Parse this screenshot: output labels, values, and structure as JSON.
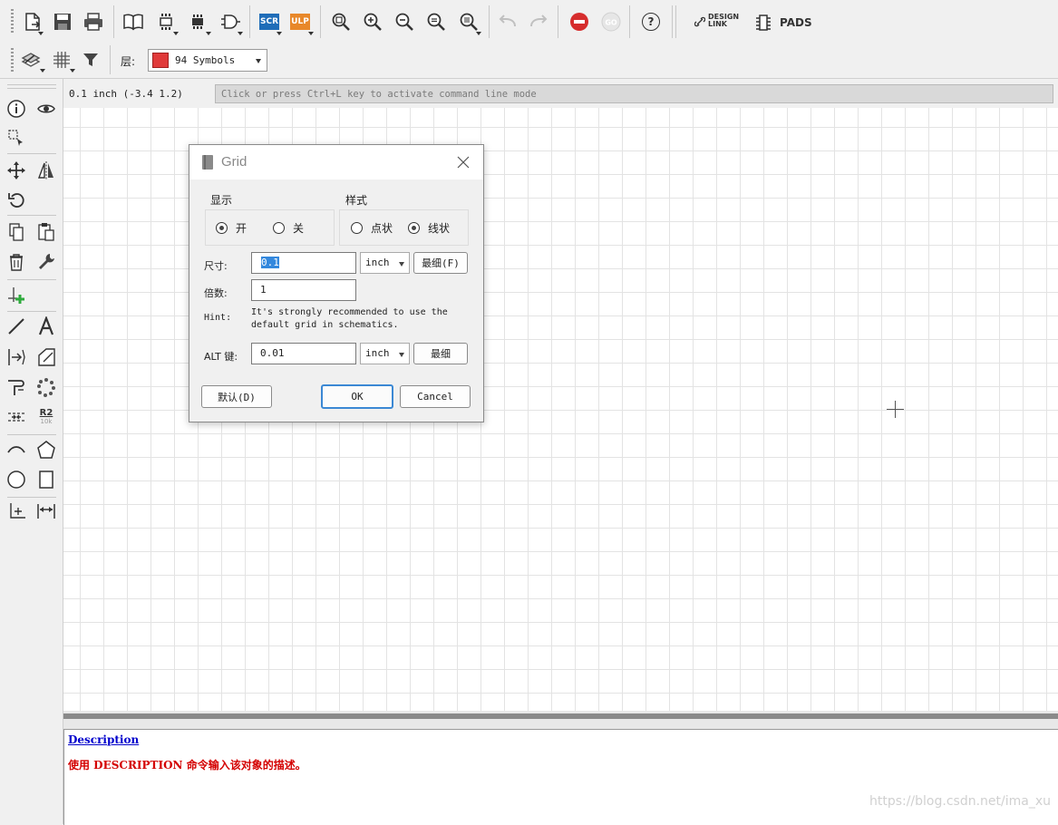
{
  "toolbar": {
    "design_link_line1": "DESIGN",
    "design_link_line2": "LINK",
    "pads_label": "PADS",
    "scr_label": "SCR",
    "ulp_label": "ULP",
    "help_label": "?"
  },
  "layerbar": {
    "layer_label": "层:",
    "layer_value": "94 Symbols",
    "layer_color": "#e03a3a"
  },
  "coordbar": {
    "coordinates": "0.1 inch (-3.4 1.2)",
    "command_placeholder": "Click or press Ctrl+L key to activate command line mode"
  },
  "lefttb": {
    "r2_label": "R2",
    "r2_sub": "10k"
  },
  "dialog": {
    "title": "Grid",
    "display_group": "显示",
    "display_on": "开",
    "display_off": "关",
    "style_group": "样式",
    "style_dots": "点状",
    "style_lines": "线状",
    "size_label": "尺寸:",
    "size_value": "0.1",
    "size_unit": "inch",
    "finest_button": "最细(F)",
    "multiple_label": "倍数:",
    "multiple_value": "1",
    "hint_label": "Hint:",
    "hint_text": "It's strongly recommended to use the default grid in schematics.",
    "alt_label": "ALT 键:",
    "alt_value": "0.01",
    "alt_unit": "inch",
    "alt_finest_button": "最细",
    "default_button": "默认(D)",
    "ok_button": "OK",
    "cancel_button": "Cancel",
    "display_selected": "on",
    "style_selected": "lines"
  },
  "description": {
    "title": "Description",
    "body": "使用 DESCRIPTION 命令输入该对象的描述。"
  },
  "watermark": "https://blog.csdn.net/ima_xu",
  "colors": {
    "stop_red": "#d62d2d",
    "scr_blue": "#1f6db8",
    "ulp_orange": "#e8882a",
    "desc_title": "#0000cc",
    "desc_body": "#d40000",
    "ok_border": "#3b88d4"
  }
}
